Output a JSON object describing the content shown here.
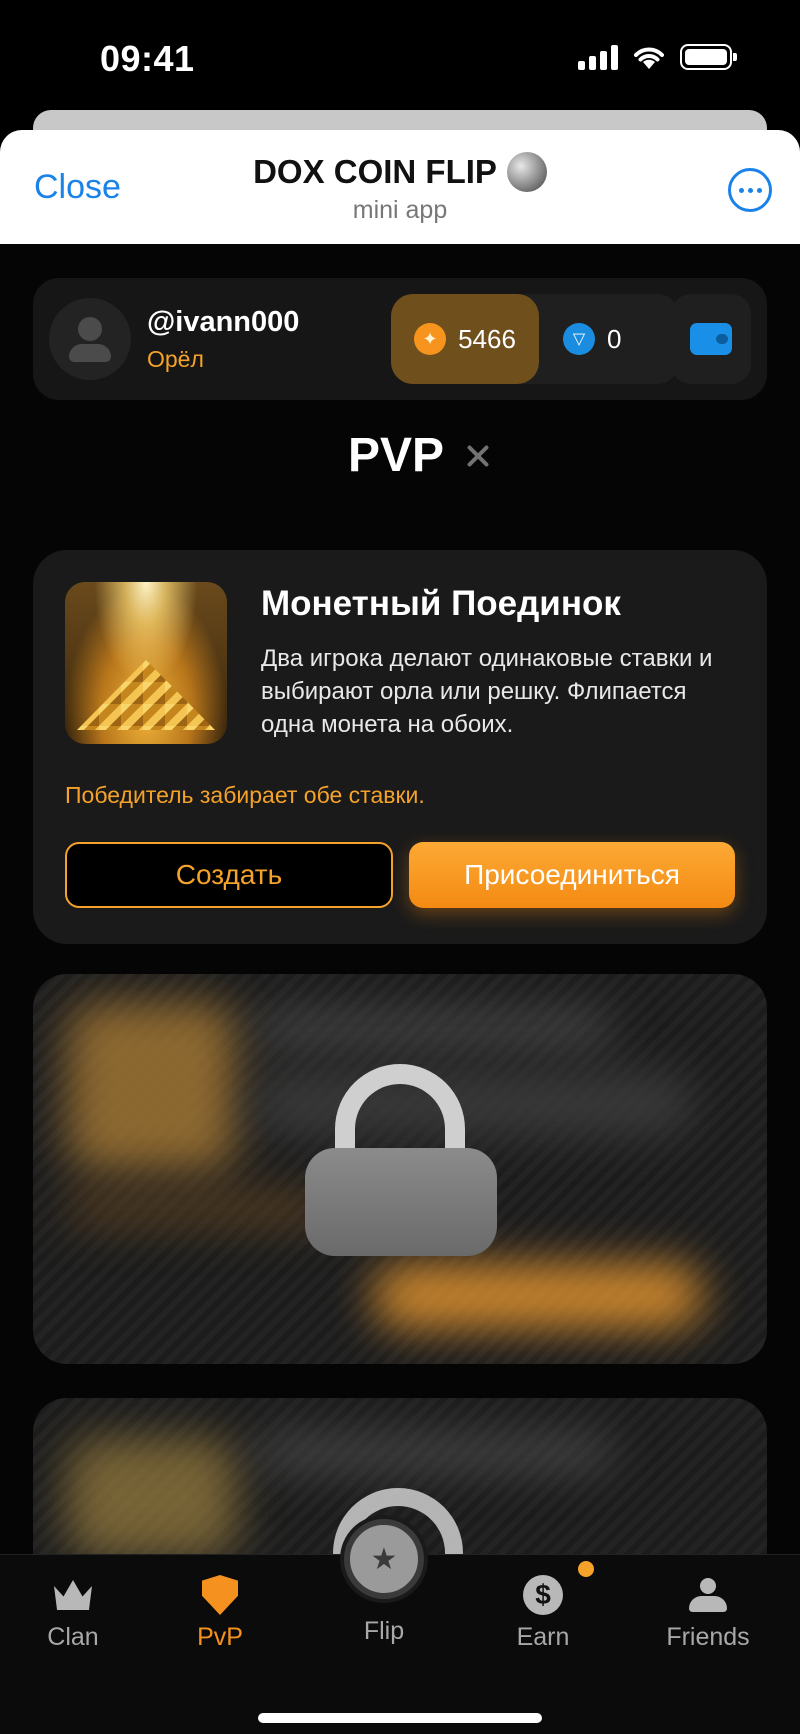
{
  "status_bar": {
    "time": "09:41"
  },
  "header": {
    "close_label": "Close",
    "title": "DOX COIN FLIP",
    "subtitle": "mini app",
    "icons": [
      "coin-icon",
      "more-icon"
    ]
  },
  "user": {
    "username": "@ivann000",
    "rank": "Орёл",
    "coins": "5466",
    "ton": "0"
  },
  "section_title": "PVP",
  "pvp_card": {
    "title": "Монетный Поединок",
    "description": "Два игрока делают одинаковые ставки и выбирают орла или решку. Флипается одна монета на обоих.",
    "note": "Победитель забирает обе ставки.",
    "create_label": "Создать",
    "join_label": "Присоединиться"
  },
  "colors": {
    "accent": "#f5911e",
    "link": "#1a82e8",
    "ton": "#1b8de0"
  },
  "nav": {
    "items": [
      {
        "label": "Clan",
        "icon": "crown-icon"
      },
      {
        "label": "PvP",
        "icon": "shield-icon",
        "active": true
      },
      {
        "label": "Flip",
        "icon": "star-icon"
      },
      {
        "label": "Earn",
        "icon": "dollar-icon"
      },
      {
        "label": "Friends",
        "icon": "friends-icon"
      }
    ]
  }
}
